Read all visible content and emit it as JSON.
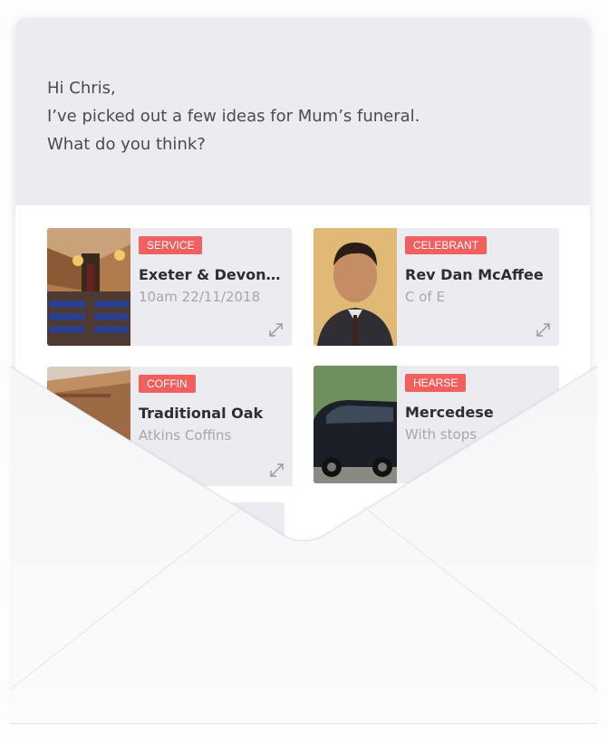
{
  "message": {
    "greeting": "Hi Chris,",
    "line1": "I’ve picked out a few ideas for Mum’s funeral.",
    "line2": "What do you think?"
  },
  "cards": [
    {
      "tag": "SERVICE",
      "title": "Exeter & Devon Cr...",
      "subtitle": "10am 22/11/2018",
      "image": "church-interior",
      "icon": "expand-icon"
    },
    {
      "tag": "CELEBRANT",
      "title": "Rev Dan McAffee",
      "subtitle": "C of E",
      "image": "celebrant-portrait",
      "icon": "expand-icon"
    },
    {
      "tag": "COFFIN",
      "title": "Traditional Oak",
      "subtitle": "Atkins Coffins",
      "image": "oak-coffin",
      "icon": "expand-icon"
    },
    {
      "tag": "HEARSE",
      "title": "Mercedese",
      "subtitle": "With stops",
      "image": "black-hearse",
      "icon": "expand-icon"
    }
  ],
  "colors": {
    "header_bg": "#ecebf0",
    "card_bg": "#ecebf0",
    "tag_bg": "#f1605c",
    "tag_text": "#ffffff",
    "text_dark": "#2d2d36",
    "text_muted": "#a7a6ad",
    "envelope": "#f9f9f9"
  }
}
